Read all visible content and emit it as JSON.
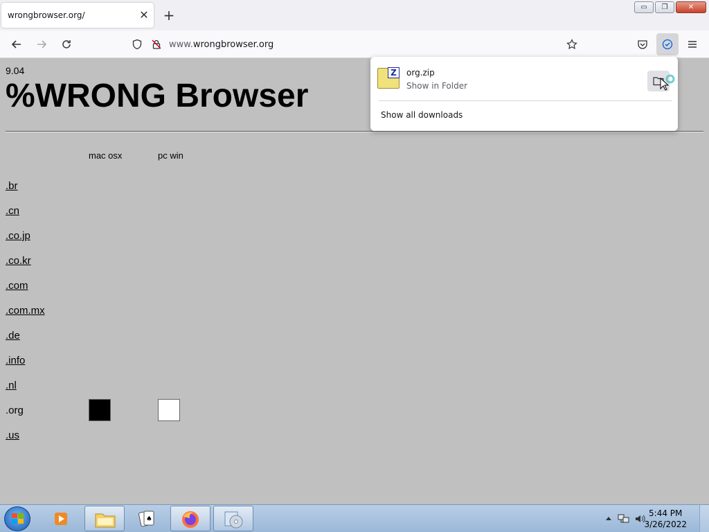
{
  "browser": {
    "tab_title": "wrongbrowser.org/",
    "tab_close": "✕",
    "new_tab": "+",
    "url_prefix": "www.",
    "url_host": "wrongbrowser.org",
    "window_buttons": [
      "▭",
      "❐",
      "✕"
    ]
  },
  "page": {
    "version": "9.04",
    "headline": "%WRONG Browser",
    "columns": [
      "mac osx",
      "pc win"
    ],
    "tlds": [
      ".br",
      ".cn",
      ".co.jp",
      ".co.kr",
      ".com",
      ".com.mx",
      ".de",
      ".info",
      ".nl",
      ".org",
      ".us"
    ],
    "active_tld": ".org"
  },
  "downloads": {
    "file_name": "org.zip",
    "file_action": "Show in Folder",
    "show_all": "Show all downloads"
  },
  "taskbar": {
    "time": "5:44 PM",
    "date": "3/26/2022"
  }
}
